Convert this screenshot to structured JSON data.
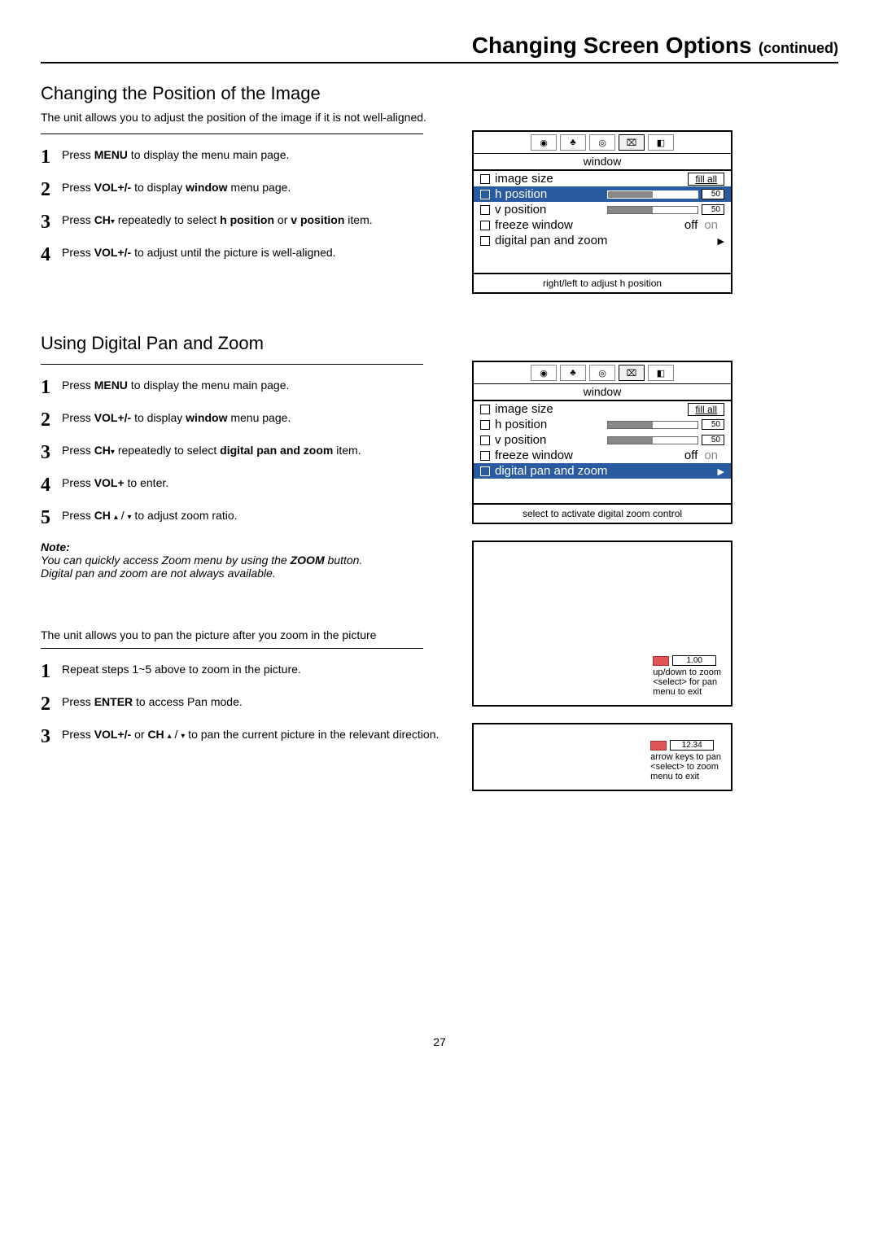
{
  "header": {
    "title": "Changing Screen Options",
    "continued": "(continued)"
  },
  "section1": {
    "title": "Changing the Position of the Image",
    "intro": "The unit allows you to adjust the position of the image if it is not well-aligned.",
    "steps": {
      "s1": {
        "pre": "Press ",
        "b1": "MENU",
        "post": " to display the menu main page."
      },
      "s2": {
        "pre": "Press ",
        "b1": "VOL+/-",
        "mid": " to display ",
        "b2": "window",
        "post": " menu page."
      },
      "s3": {
        "pre": "Press ",
        "b1": "CH",
        "mid": " repeatedly to select ",
        "b2": "h position",
        "mid2": " or ",
        "b3": "v position",
        "post": " item."
      },
      "s4": {
        "pre": "Press ",
        "b1": "VOL+/-",
        "post": " to adjust until the picture is well-aligned."
      }
    }
  },
  "section2": {
    "title": "Using Digital Pan and Zoom",
    "steps": {
      "s1": {
        "pre": "Press ",
        "b1": "MENU",
        "post": " to display the menu main page."
      },
      "s2": {
        "pre": "Press ",
        "b1": "VOL+/-",
        "mid": " to display ",
        "b2": "window",
        "post": " menu page."
      },
      "s3": {
        "pre": "Press ",
        "b1": "CH",
        "mid": " repeatedly to select ",
        "b2": "digital pan and zoom",
        "post": " item."
      },
      "s4": {
        "pre": "Press ",
        "b1": "VOL+",
        "post": " to enter."
      },
      "s5": {
        "pre": "Press ",
        "b1": "CH",
        "post": "  to adjust zoom ratio."
      }
    },
    "note_head": "Note:",
    "note_l1": "You can quickly access Zoom menu by using the ",
    "note_b": "ZOOM",
    "note_l1b": " button.",
    "note_l2": "Digital pan and zoom are not always available.",
    "intro2": "The unit allows you to pan the picture after you zoom in the picture",
    "steps2": {
      "s1": "Repeat steps 1~5 above to zoom in the picture.",
      "s2": {
        "pre": "Press ",
        "b1": "ENTER",
        "post": " to access Pan mode."
      },
      "s3": {
        "pre": "Press ",
        "b1": "VOL+/-",
        "mid": " or ",
        "b2": "CH",
        "post": "  to pan the current picture in the relevant direction."
      }
    }
  },
  "osd1": {
    "subtitle": "window",
    "rows": {
      "image_size": {
        "label": "image size",
        "value": "fill all"
      },
      "h_position": {
        "label": "h position",
        "value": "50"
      },
      "v_position": {
        "label": "v position",
        "value": "50"
      },
      "freeze": {
        "label": "freeze window",
        "off": "off",
        "on": "on"
      },
      "dpz": {
        "label": "digital pan and zoom"
      }
    },
    "caption": "right/left to adjust h position"
  },
  "osd2": {
    "subtitle": "window",
    "rows": {
      "image_size": {
        "label": "image size",
        "value": "fill all"
      },
      "h_position": {
        "label": "h position",
        "value": "50"
      },
      "v_position": {
        "label": "v position",
        "value": "50"
      },
      "freeze": {
        "label": "freeze window",
        "off": "off",
        "on": "on"
      },
      "dpz": {
        "label": "digital pan and zoom"
      }
    },
    "caption": "select to activate digital zoom control"
  },
  "zoom1": {
    "value": "1.00",
    "l1": "up/down to zoom",
    "l2": "<select> for pan",
    "l3": "menu to exit"
  },
  "zoom2": {
    "value": "12.34",
    "l1": "arrow keys to pan",
    "l2": "<select> to zoom",
    "l3": "menu to exit"
  },
  "page_number": "27"
}
